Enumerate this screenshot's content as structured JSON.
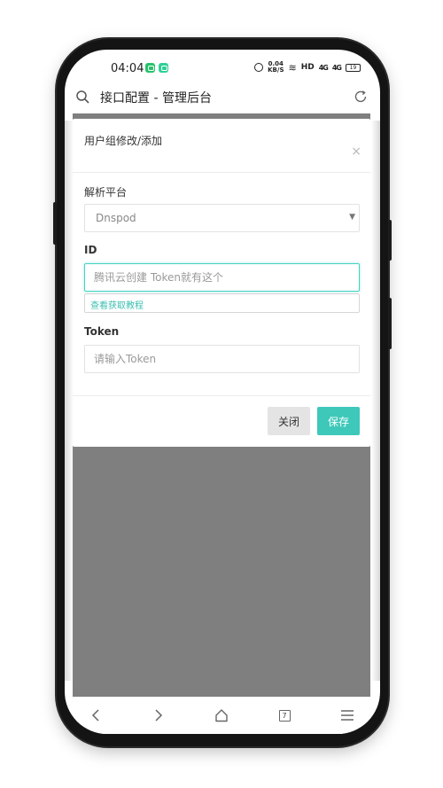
{
  "status_bar": {
    "time": "04:04",
    "net_speed_value": "0.04",
    "net_speed_unit": "KB/S",
    "hd_label": "HD",
    "signal1": "4G",
    "signal2": "4G",
    "battery": "19"
  },
  "browser": {
    "page_title": "接口配置 - 管理后台"
  },
  "modal": {
    "title": "用户组修改/添加",
    "close_symbol": "×",
    "platform": {
      "label": "解析平台",
      "selected": "Dnspod"
    },
    "id_field": {
      "label": "ID",
      "placeholder": "腾讯云创建 Token就有这个",
      "value": "",
      "help_link": "查看获取教程"
    },
    "token_field": {
      "label": "Token",
      "placeholder": "请输入Token",
      "value": ""
    },
    "buttons": {
      "close": "关闭",
      "save": "保存"
    }
  },
  "bottom_nav": {
    "tab_count": "7"
  },
  "colors": {
    "accent": "#3ec8ba",
    "overlay": "#7f7f7f",
    "close_button_bg": "#e4e4e4"
  },
  "icons": [
    "search-icon",
    "refresh-icon",
    "close-icon",
    "back-icon",
    "forward-icon",
    "home-icon",
    "tabs-icon",
    "menu-icon",
    "alarm-icon",
    "wifi-icon",
    "battery-icon"
  ]
}
